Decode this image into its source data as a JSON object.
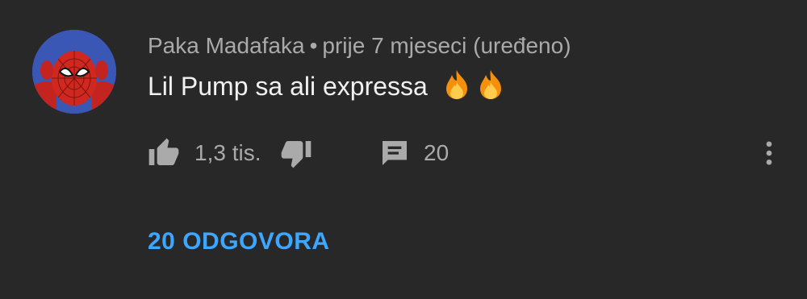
{
  "comment": {
    "author": "Paka Madafaka",
    "separator": "•",
    "time": "prije 7 mjeseci (uređeno)",
    "text": "Lil Pump sa ali expressa",
    "emojis": [
      "fire",
      "fire"
    ],
    "like_count": "1,3 tis.",
    "reply_count": "20",
    "replies_link": "20 ODGOVORA"
  },
  "colors": {
    "background": "#282828",
    "text": "#f1f1f1",
    "meta": "#aaaaaa",
    "link": "#3ea6ff"
  },
  "icons": {
    "like": "thumbs-up-icon",
    "dislike": "thumbs-down-icon",
    "reply": "comment-icon",
    "more": "more-vert-icon"
  }
}
